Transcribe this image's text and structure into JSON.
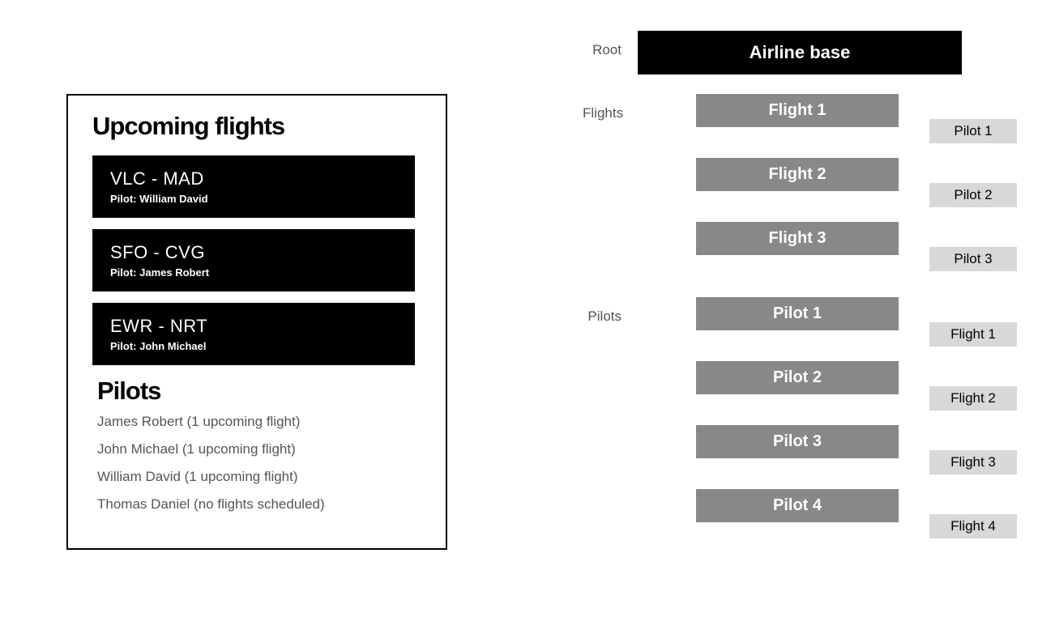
{
  "left": {
    "upcoming_title": "Upcoming flights",
    "flights": [
      {
        "route": "VLC - MAD",
        "pilot": "Pilot: William David"
      },
      {
        "route": "SFO - CVG",
        "pilot": "Pilot: James Robert"
      },
      {
        "route": "EWR - NRT",
        "pilot": "Pilot: John Michael"
      }
    ],
    "pilots_title": "Pilots",
    "pilots": [
      "James Robert (1 upcoming flight)",
      "John Michael (1 upcoming flight)",
      "William David (1 upcoming flight)",
      "Thomas Daniel (no flights scheduled)"
    ]
  },
  "right": {
    "root_label": "Root",
    "root_title": "Airline base",
    "flights_label": "Flights",
    "flights": [
      {
        "box": "Flight 1",
        "leaf": "Pilot 1"
      },
      {
        "box": "Flight 2",
        "leaf": "Pilot 2"
      },
      {
        "box": "Flight 3",
        "leaf": "Pilot 3"
      }
    ],
    "pilots_label": "Pilots",
    "pilots": [
      {
        "box": "Pilot 1",
        "leaf": "Flight 1"
      },
      {
        "box": "Pilot 2",
        "leaf": "Flight 2"
      },
      {
        "box": "Pilot 3",
        "leaf": "Flight 3"
      },
      {
        "box": "Pilot 4",
        "leaf": "Flight 4"
      }
    ]
  }
}
